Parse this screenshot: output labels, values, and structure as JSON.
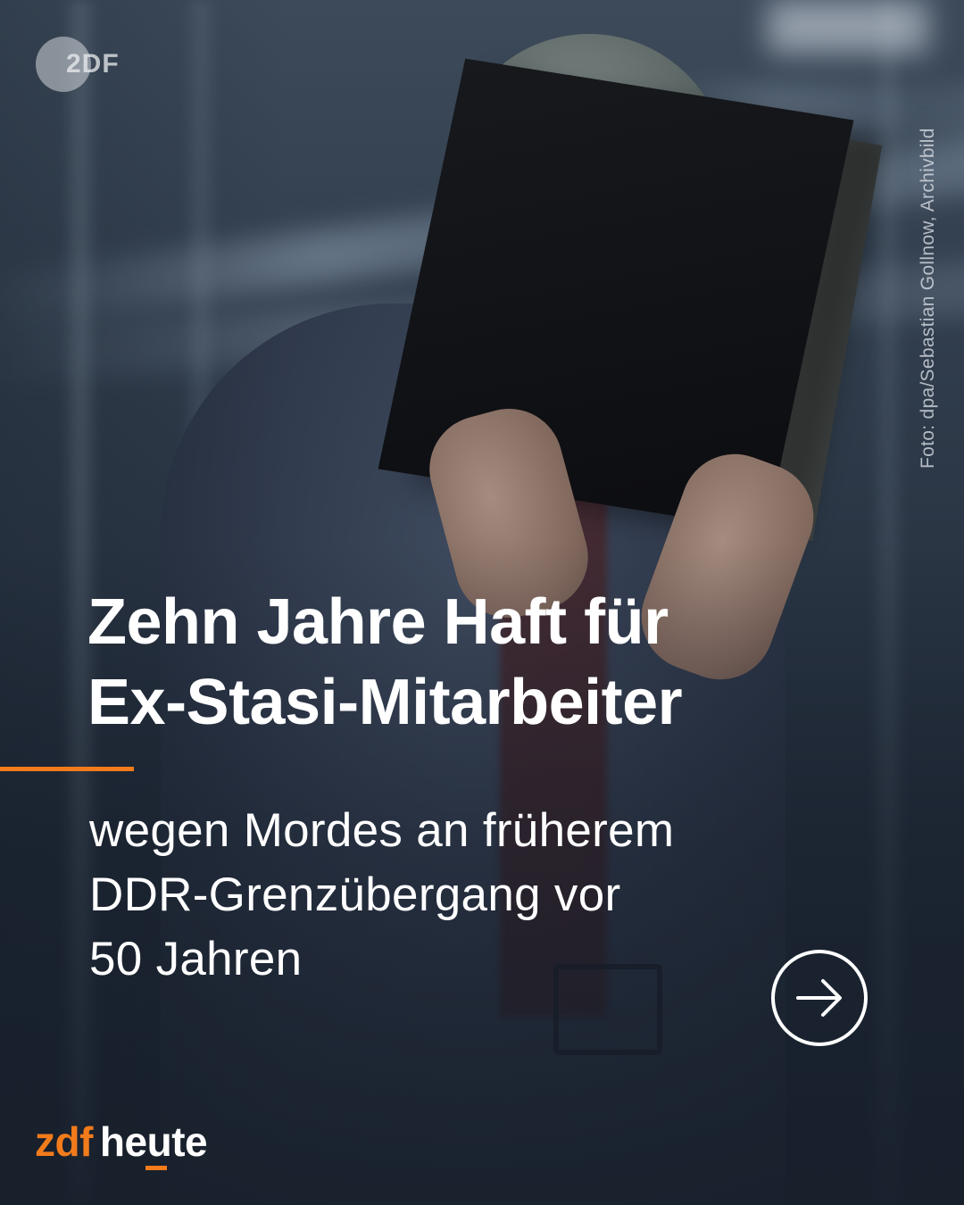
{
  "top_logo": {
    "text": "2DF",
    "icon": "zdf-circle-logo"
  },
  "photo_credit": "Foto: dpa/Sebastian Gollnow, Archivbild",
  "headline": {
    "line1": "Zehn Jahre Haft für",
    "line2": "Ex-Stasi-Mitarbeiter"
  },
  "subline": {
    "line1": "wegen Mordes an früherem",
    "line2": "DDR-Grenzübergang vor",
    "line3": "50 Jahren"
  },
  "next_button": {
    "icon": "arrow-right-circle-icon"
  },
  "brand": {
    "part1": "zdf",
    "part2": "heute"
  },
  "colors": {
    "accent": "#f27b1b",
    "text": "#ffffff",
    "background": "#1a2331"
  }
}
